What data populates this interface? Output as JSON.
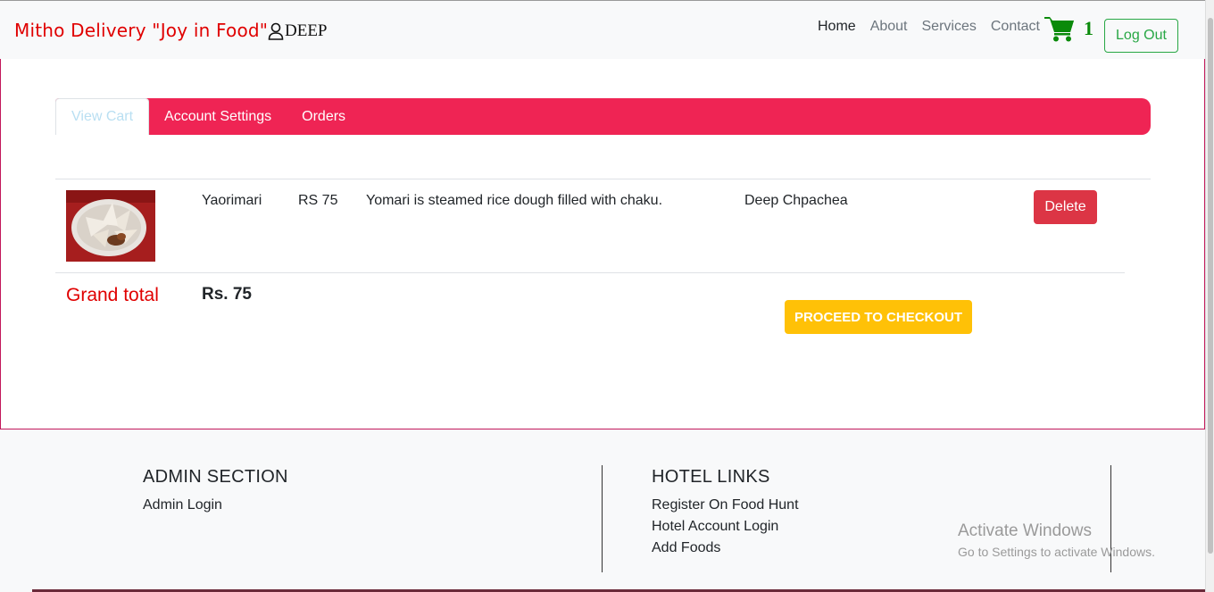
{
  "navbar": {
    "brand": "Mitho Delivery \"Joy in Food\"",
    "username": "DEEP",
    "links": [
      "Home",
      "About",
      "Services",
      "Contact"
    ],
    "cart_count": "1",
    "logout_label": "Log Out"
  },
  "tabs": [
    "View Cart",
    "Account Settings",
    "Orders"
  ],
  "cart": {
    "items": [
      {
        "name": "Yaorimari",
        "price": "RS 75",
        "description": "Yomari is steamed rice dough filled with chaku.",
        "hotel": "Deep Chpachea",
        "delete_label": "Delete"
      }
    ],
    "grand_total_label": "Grand total",
    "grand_total_value": "Rs. 75",
    "checkout_label": "PROCEED TO CHECKOUT"
  },
  "footer": {
    "admin_heading": "ADMIN SECTION",
    "admin_links": [
      "Admin Login"
    ],
    "hotel_heading": "HOTEL LINKS",
    "hotel_links": [
      "Register On Food Hunt",
      "Hotel Account Login",
      "Add Foods"
    ]
  },
  "watermark": {
    "title": "Activate Windows",
    "subtitle": "Go to Settings to activate Windows."
  }
}
